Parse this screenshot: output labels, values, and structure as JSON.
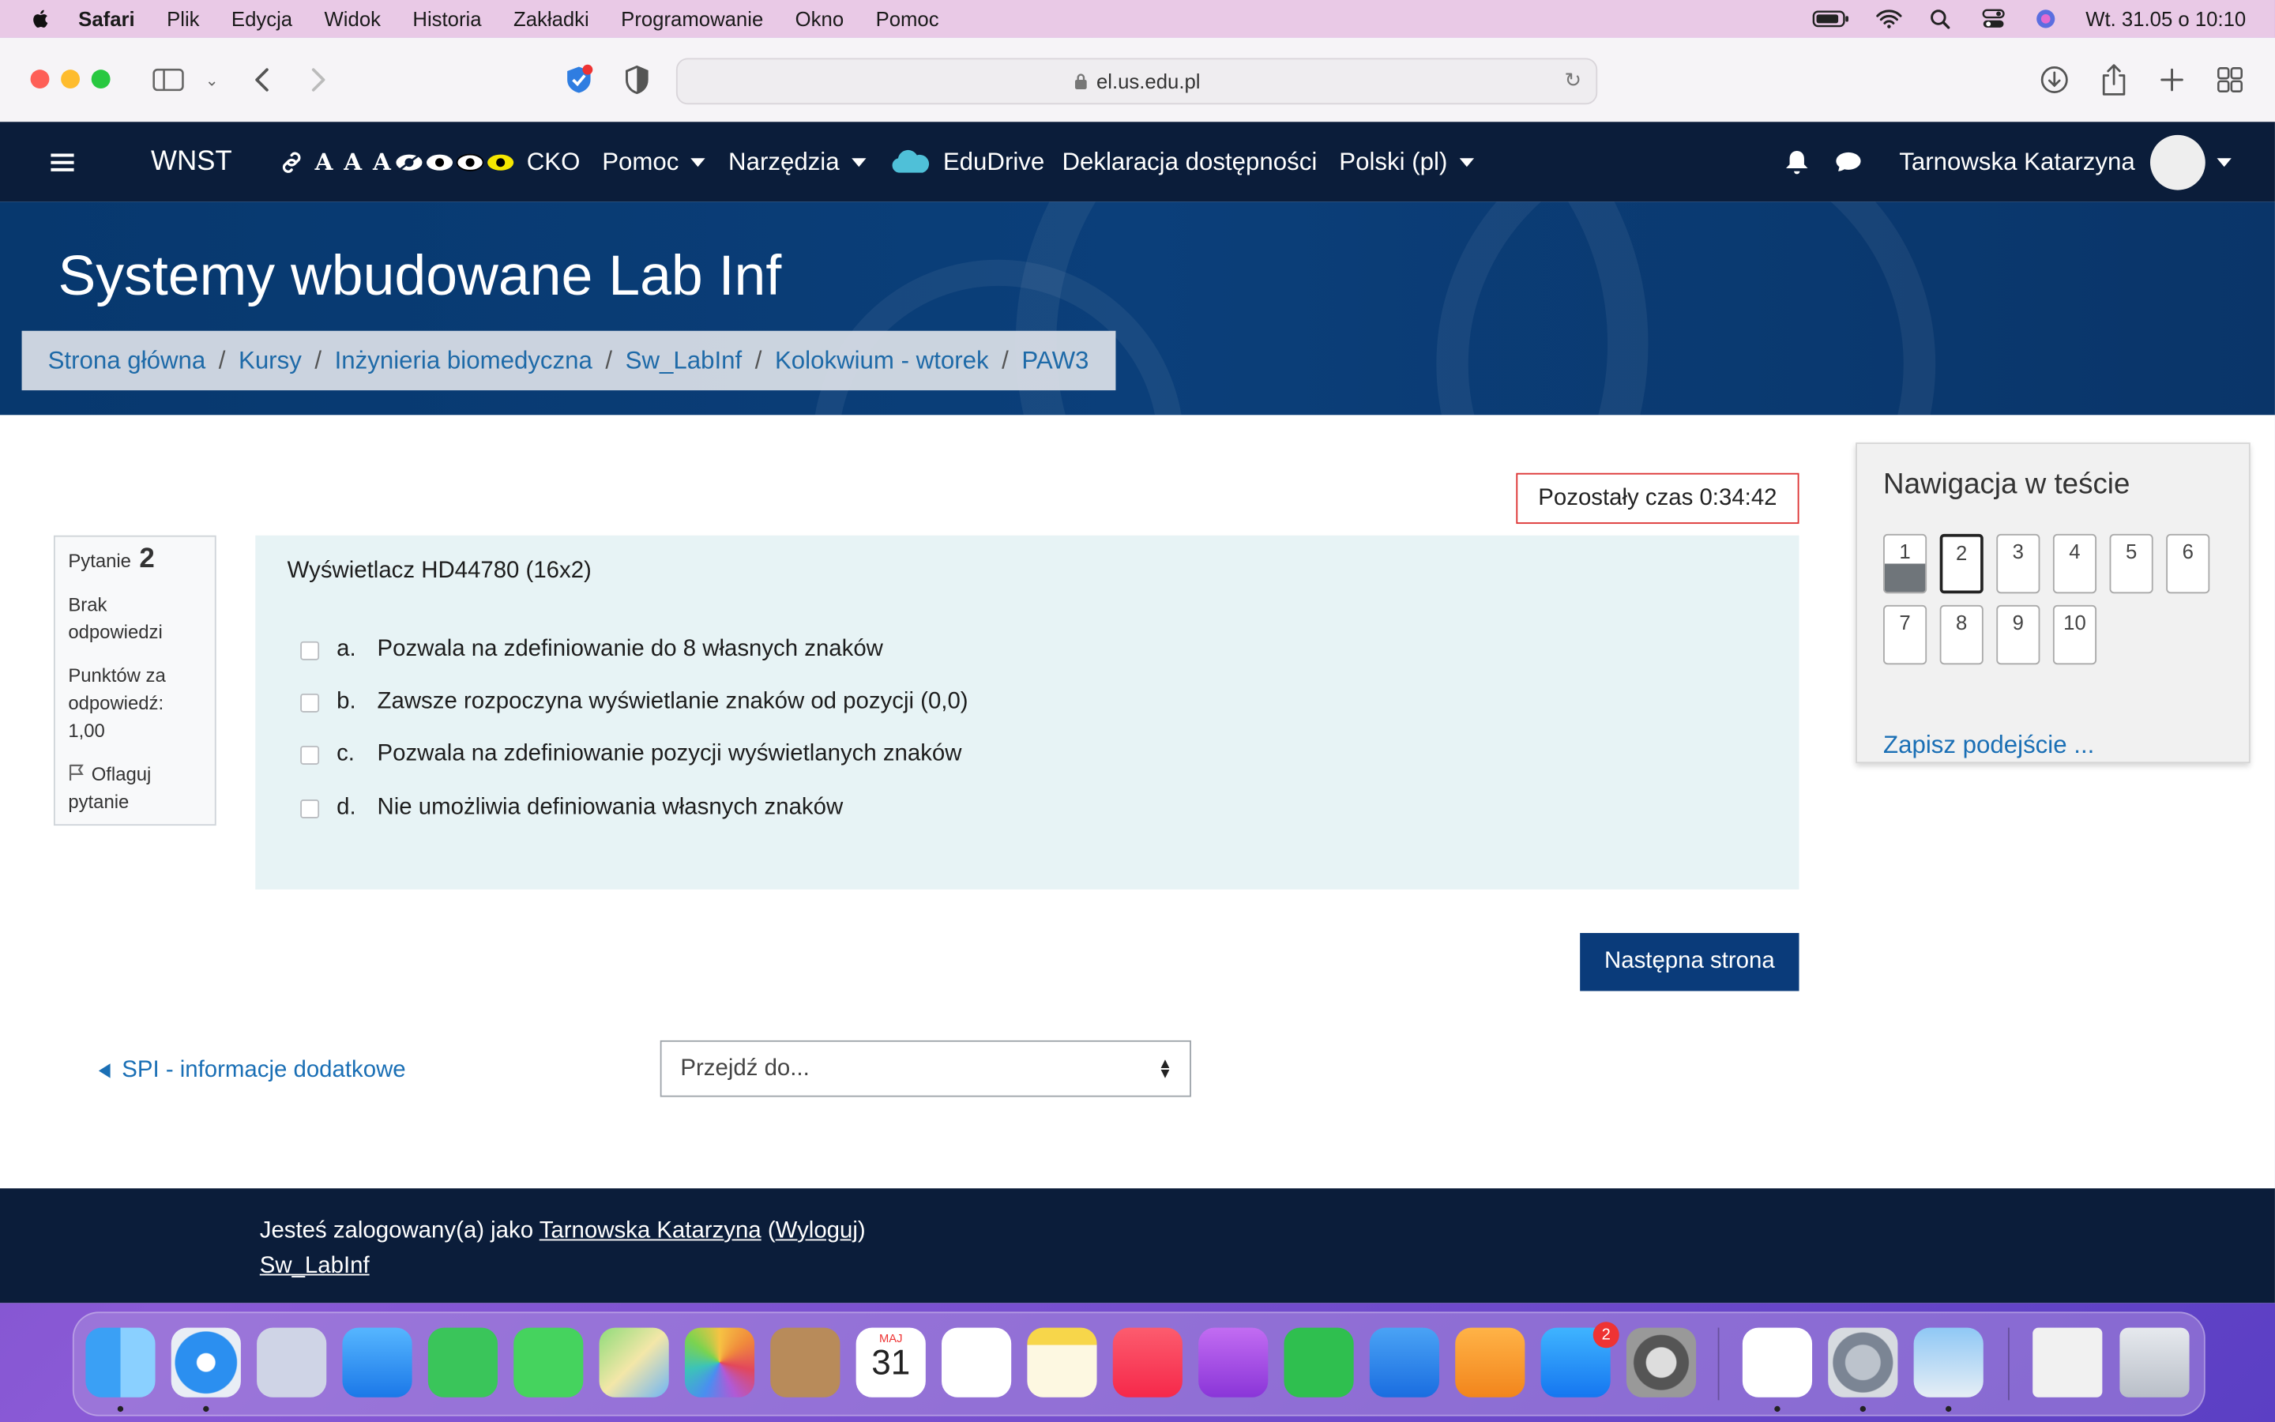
{
  "menubar": {
    "app": "Safari",
    "items": [
      "Plik",
      "Edycja",
      "Widok",
      "Historia",
      "Zakładki",
      "Programowanie",
      "Okno",
      "Pomoc"
    ],
    "datetime": "Wt. 31.05 o  10:10"
  },
  "browser": {
    "url": "el.us.edu.pl"
  },
  "navbar": {
    "site": "WNST",
    "accessibility_text": "A A A",
    "cko": "CKO",
    "help": "Pomoc",
    "tools": "Narzędzia",
    "edudrive": "EduDrive",
    "accessibility_declaration": "Deklaracja dostępności",
    "language": "Polski (pl)",
    "user": "Tarnowska Katarzyna"
  },
  "header": {
    "course_title": "Systemy wbudowane Lab Inf",
    "breadcrumb": [
      "Strona główna",
      "Kursy",
      "Inżynieria biomedyczna",
      "Sw_LabInf",
      "Kolokwium - wtorek",
      "PAW3"
    ]
  },
  "timer": {
    "text": "Pozostały czas 0:34:42"
  },
  "question_info": {
    "label": "Pytanie",
    "number": "2",
    "status_1": "Brak",
    "status_2": "odpowiedzi",
    "points_1": "Punktów za",
    "points_2": "odpowiedź:",
    "points_3": "1,00",
    "flag_1": "Oflaguj",
    "flag_2": "pytanie"
  },
  "question": {
    "text": "Wyświetlacz HD44780 (16x2)",
    "options": [
      {
        "letter": "a.",
        "text": "Pozwala na zdefiniowanie do 8 własnych znaków"
      },
      {
        "letter": "b.",
        "text": "Zawsze rozpoczyna wyświetlanie znaków od pozycji (0,0)"
      },
      {
        "letter": "c.",
        "text": "Pozwala na zdefiniowanie pozycji wyświetlanych znaków"
      },
      {
        "letter": "d.",
        "text": "Nie umożliwia definiowania własnych znaków"
      }
    ]
  },
  "actions": {
    "next_page": "Następna strona",
    "prev_activity": "SPI - informacje dodatkowe",
    "jump_placeholder": "Przejdź do..."
  },
  "quiz_nav": {
    "title": "Nawigacja w teście",
    "questions": [
      "1",
      "2",
      "3",
      "4",
      "5",
      "6",
      "7",
      "8",
      "9",
      "10"
    ],
    "finish": "Zapisz podejście ..."
  },
  "footer": {
    "logged_in_prefix": "Jesteś zalogowany(a) jako ",
    "user": "Tarnowska Katarzyna",
    "logout": "Wyloguj",
    "course_link": "Sw_LabInf"
  },
  "dock": {
    "calendar_month": "MAJ",
    "calendar_day": "31",
    "appstore_badge": "2"
  }
}
